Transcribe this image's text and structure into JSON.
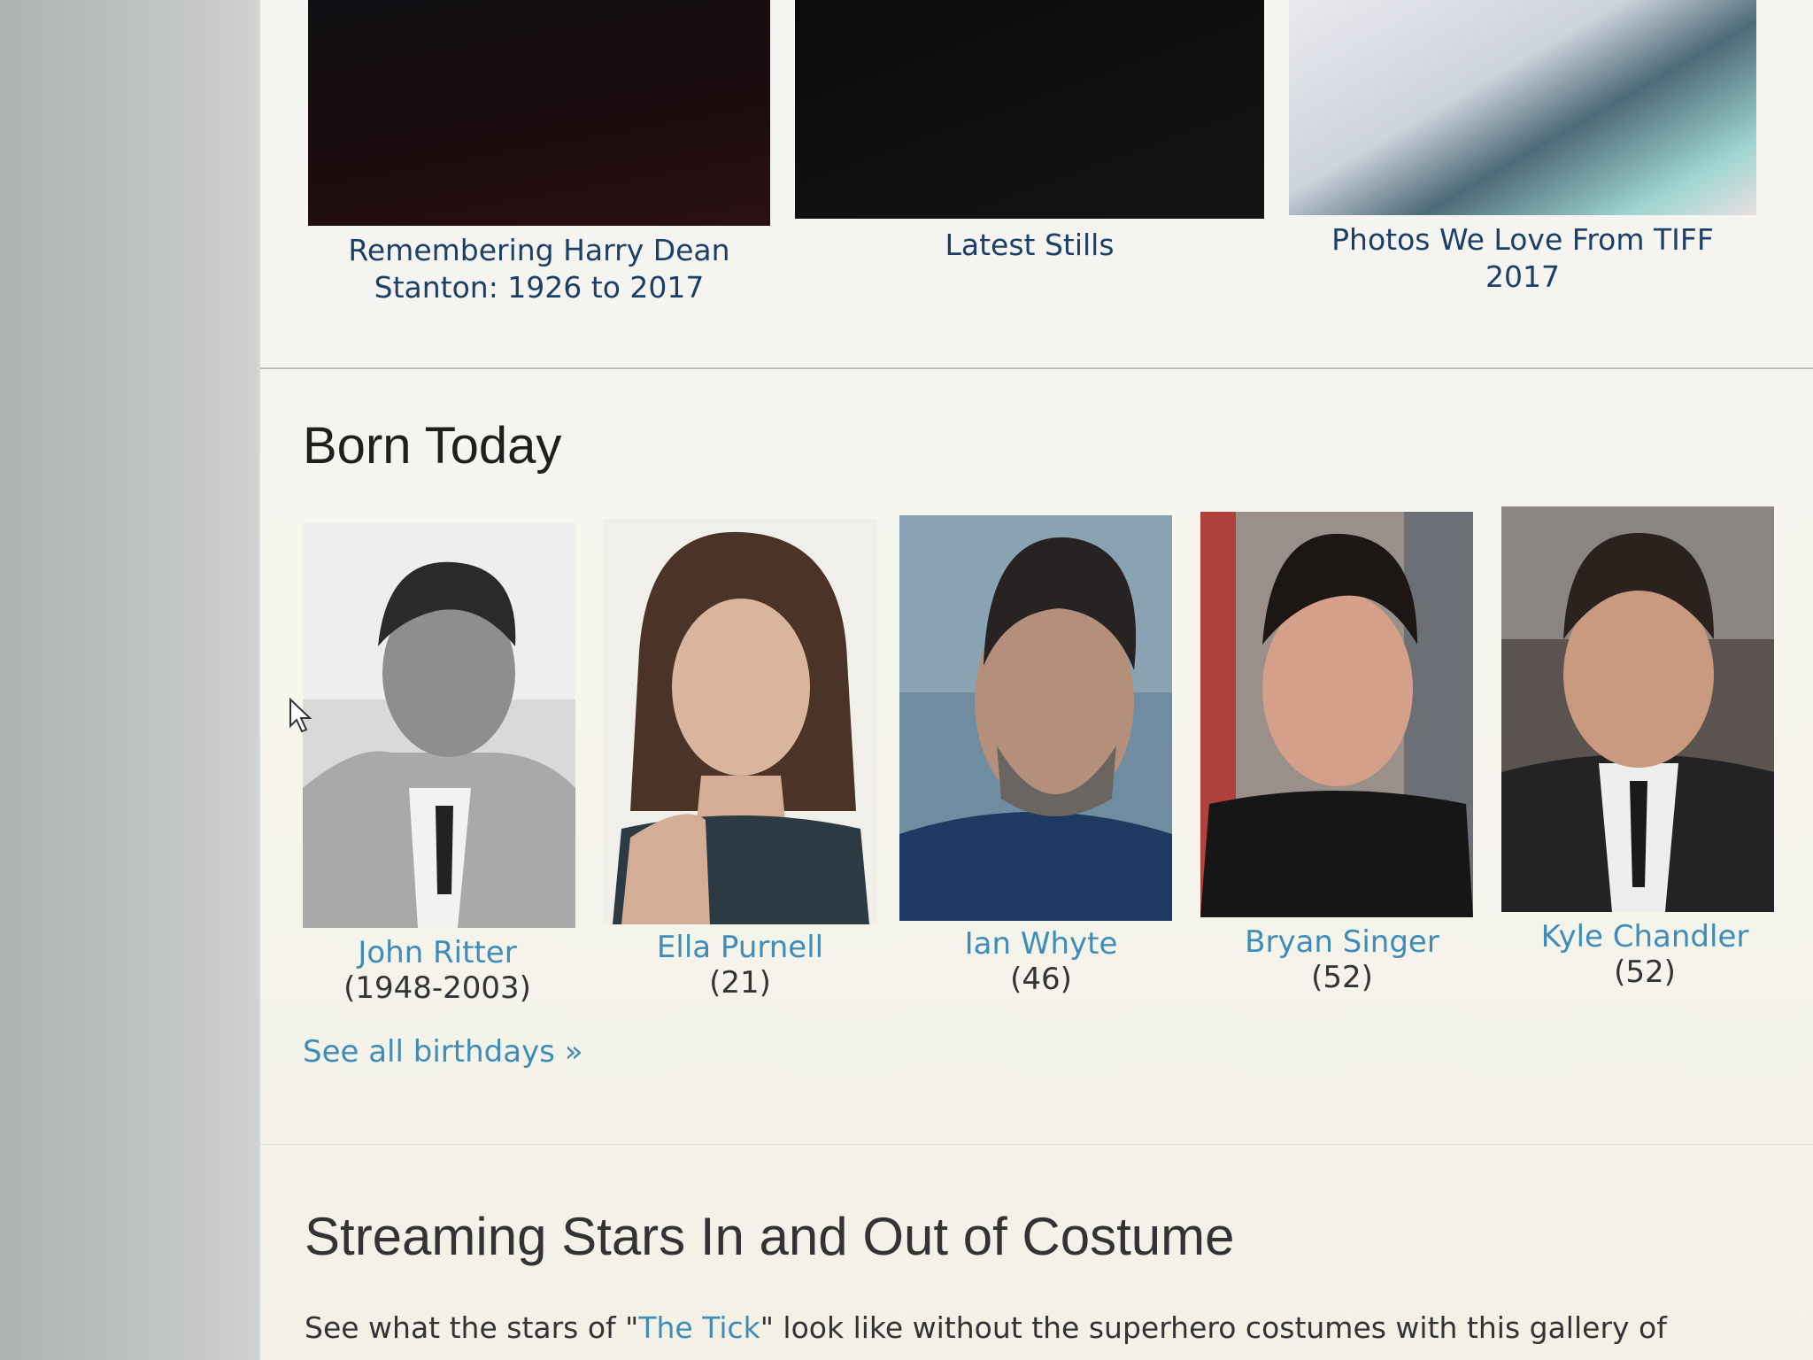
{
  "gallery": [
    {
      "caption_line1": "Remembering Harry Dean",
      "caption_line2": "Stanton: 1926 to 2017"
    },
    {
      "caption_line1": "Latest Stills",
      "caption_line2": ""
    },
    {
      "caption_line1": "Photos We Love From TIFF",
      "caption_line2": "2017"
    }
  ],
  "born_today": {
    "title": "Born Today",
    "people": [
      {
        "name": "John Ritter",
        "detail": "(1948-2003)"
      },
      {
        "name": "Ella Purnell",
        "detail": "(21)"
      },
      {
        "name": "Ian Whyte",
        "detail": "(46)"
      },
      {
        "name": "Bryan Singer",
        "detail": "(52)"
      },
      {
        "name": "Kyle Chandler",
        "detail": "(52)"
      }
    ],
    "see_all": "See all birthdays »"
  },
  "streaming": {
    "title": "Streaming Stars In and Out of Costume",
    "desc_before": "See what the stars of \"",
    "desc_link": "The Tick",
    "desc_after": "\" look like without the superhero costumes with this gallery of"
  }
}
